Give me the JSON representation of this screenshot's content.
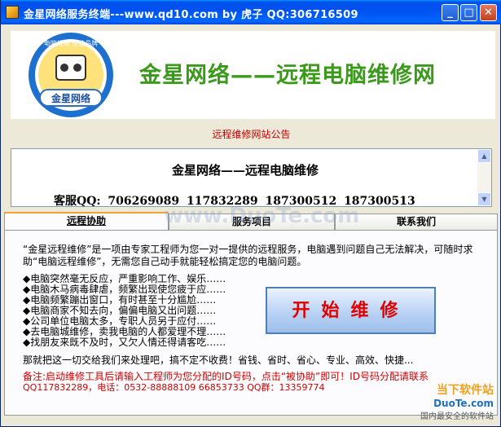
{
  "window": {
    "title": "金星网络服务终端---www.qd10.com by 虎子 QQ:306716509",
    "minimize": "_",
    "maximize": "□",
    "close": "✕"
  },
  "header": {
    "logo_top_text": "电脑维修 首选品牌",
    "logo_text": "金星网络",
    "brand": "金星网络——远程电脑维修网"
  },
  "notice": {
    "title": "远程维修网站公告",
    "headline": "金星网络——远程电脑维修",
    "qq_line": "客服QQ: 706269089 117832289 187300512 187300513"
  },
  "tabs": [
    "远程协助",
    "服务项目",
    "联系我们"
  ],
  "main": {
    "intro": "“金星远程维修”是一项由专家工程师为您一对一提供的远程服务，电脑遇到问题自己无法解决，可随时求助“电脑远程维修”，无需您自己动手就能轻松搞定您的电脑问题。",
    "bullets": [
      "◆电脑突然毫无反应，严重影响工作、娱乐……",
      "◆电脑木马病毒肆虐，频繁出现使您疲于应……",
      "◆电脑频繁蹦出窗口，有时甚至十分尴尬……",
      "◆电脑商家不知去向，偏偏电脑又出问题……",
      "◆公司单位电脑太多，专职人员另于应付……",
      "◆去电脑城维修，卖我电脑的人都爱理不理……",
      "◆找朋友来既不及时，又欠人情还得请客吃……"
    ],
    "start_button": "开始维修",
    "slogan": "那就把这一切交给我们来处理吧，搞不定不收费！省钱、省时、省心、专业、高效、快捷...",
    "note1": "备注:启动维修工具后请输入工程师为您分配的ID号码，点击“被协助”即可！ID号码分配请联系",
    "note2": "QQ117832289，电话：0532-88888109  66853733 QQ群：13359774"
  },
  "watermark": {
    "line1": "当下软件站",
    "line2": "DuoTe.com",
    "line3": "国内最安全的软件站",
    "center": "www.DuoTe.com"
  },
  "colors": {
    "title_bar": "#0053ee",
    "brand_green": "#3a9a1a",
    "accent_red": "#d00000"
  }
}
